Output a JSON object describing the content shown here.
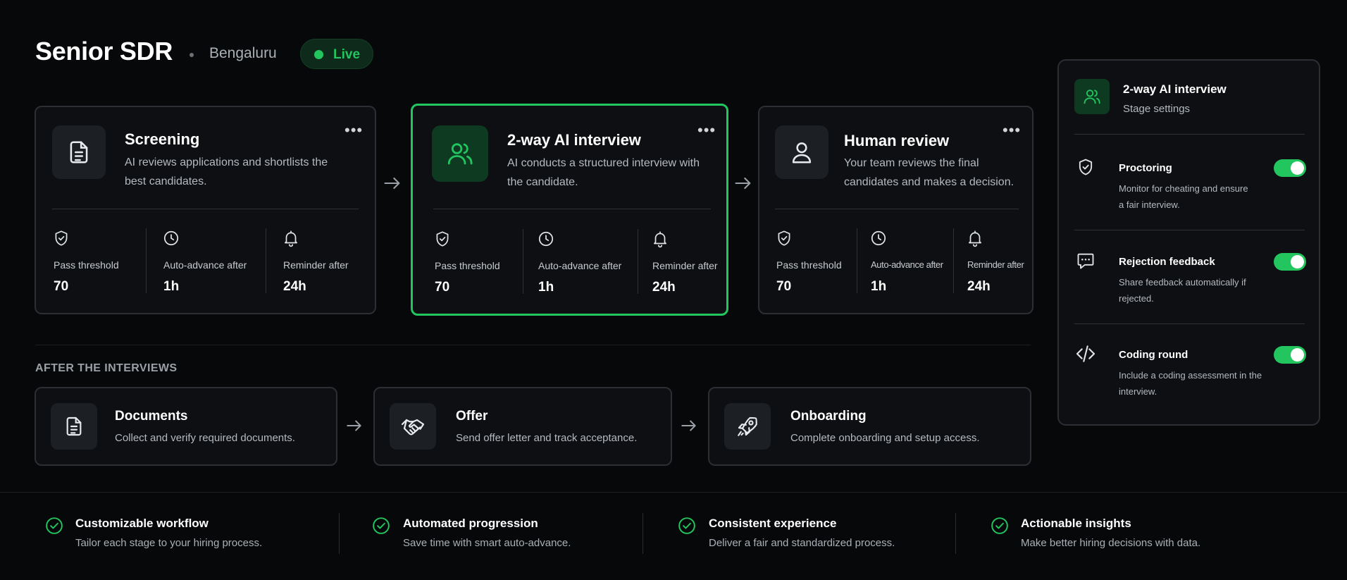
{
  "header": {
    "job_title": "Senior SDR",
    "location": "Bengaluru",
    "status_label": "Live"
  },
  "stages": [
    {
      "title": "Screening",
      "description": "AI reviews applications and shortlists the best candidates.",
      "icon": "document-icon",
      "active": false,
      "metrics": [
        {
          "icon": "shield-check-icon",
          "label": "Pass threshold",
          "value": "70"
        },
        {
          "icon": "clock-icon",
          "label": "Auto-advance after",
          "value": "1h"
        },
        {
          "icon": "bell-icon",
          "label": "Reminder after",
          "value": "24h"
        }
      ]
    },
    {
      "title": "2-way AI interview",
      "description": "AI conducts a structured interview with the candidate.",
      "icon": "users-icon",
      "active": true,
      "metrics": [
        {
          "icon": "shield-check-icon",
          "label": "Pass threshold",
          "value": "70"
        },
        {
          "icon": "clock-icon",
          "label": "Auto-advance after",
          "value": "1h"
        },
        {
          "icon": "bell-icon",
          "label": "Reminder after",
          "value": "24h"
        }
      ]
    },
    {
      "title": "Human review",
      "description": "Your team reviews the final candidates and makes a decision.",
      "icon": "user-icon",
      "active": false,
      "metrics": [
        {
          "icon": "shield-check-icon",
          "label": "Pass threshold",
          "value": "70"
        },
        {
          "icon": "clock-icon",
          "label": "Auto-advance after",
          "value": "1h"
        },
        {
          "icon": "bell-icon",
          "label": "Reminder after",
          "value": "24h"
        }
      ]
    }
  ],
  "after_section": {
    "title": "AFTER THE INTERVIEWS",
    "steps": [
      {
        "title": "Documents",
        "description": "Collect and verify required documents.",
        "icon": "document-icon"
      },
      {
        "title": "Offer",
        "description": "Send offer letter and track acceptance.",
        "icon": "handshake-icon"
      },
      {
        "title": "Onboarding",
        "description": "Complete onboarding and setup access.",
        "icon": "rocket-icon"
      }
    ]
  },
  "settings_panel": {
    "title": "2-way AI interview",
    "subtitle": "Stage settings",
    "settings": [
      {
        "title": "Proctoring",
        "description": "Monitor for cheating and ensure a fair interview.",
        "icon": "shield-check-icon",
        "enabled": true
      },
      {
        "title": "Rejection feedback",
        "description": "Share feedback automatically if rejected.",
        "icon": "message-icon",
        "enabled": true
      },
      {
        "title": "Coding round",
        "description": "Include a coding assessment in the interview.",
        "icon": "code-icon",
        "enabled": true
      }
    ]
  },
  "benefits": [
    {
      "title": "Customizable workflow",
      "description": "Tailor each stage to your hiring process."
    },
    {
      "title": "Automated progression",
      "description": "Save time with smart auto-advance."
    },
    {
      "title": "Consistent experience",
      "description": "Deliver a fair and standardized process."
    },
    {
      "title": "Actionable insights",
      "description": "Make better hiring decisions with data."
    }
  ],
  "colors": {
    "accent": "#22c55e",
    "background": "#07080a",
    "card": "#0d0f12",
    "border": "#2b2f33"
  }
}
